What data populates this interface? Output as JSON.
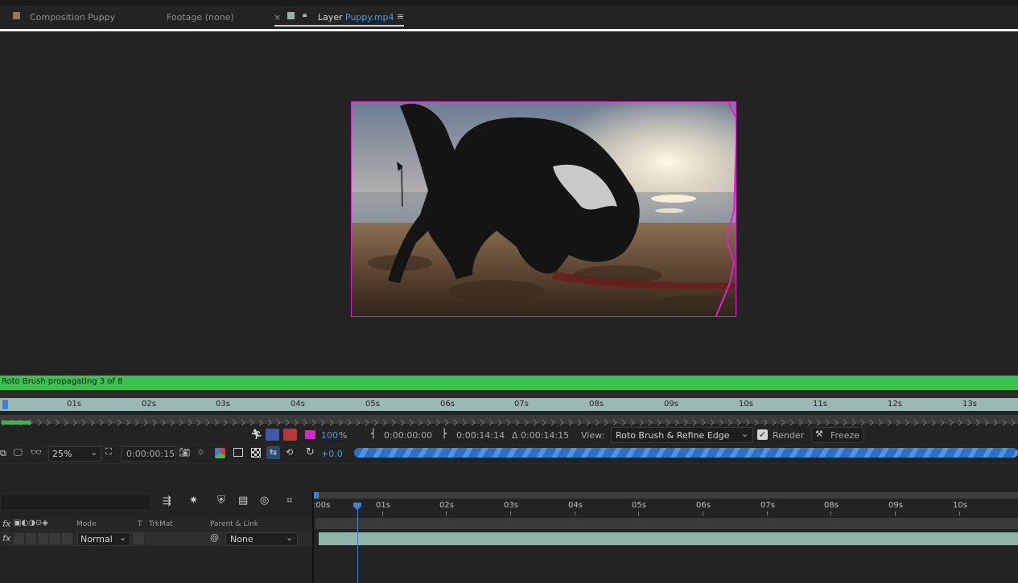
{
  "tabs": [
    {
      "label": "Composition Puppy",
      "color": "#8b7a67"
    },
    {
      "label": "Footage (none)"
    },
    {
      "label": "Layer",
      "link": "Puppy.mp4",
      "close": "×",
      "menu": "≡",
      "color": "#8fb5aa"
    }
  ],
  "roto_status": "Roto Brush propagating 3 of 8",
  "layer_ruler": {
    "ticks": [
      "01s",
      "02s",
      "03s",
      "04s",
      "05s",
      "06s",
      "07s",
      "08s",
      "09s",
      "10s",
      "11s",
      "12s",
      "13s"
    ]
  },
  "roto_toolbar": {
    "percent_value": "100",
    "percent_sign": "%",
    "in_time": "0:00:00:00",
    "out_time": "0:00:14:14",
    "duration": "Δ 0:00:14:15",
    "view_label": "View:",
    "view_value": "Roto Brush & Refine Edge",
    "render_label": "Render",
    "freeze_label": "Freeze",
    "overlay_color": "#e01fd0"
  },
  "viewer_controls": {
    "zoom": "25%",
    "timecode": "0:00:00:15",
    "exposure": "+0.0",
    "progress": 1.0
  },
  "timeline": {
    "ruler_ticks": [
      ":00s",
      "01s",
      "02s",
      "03s",
      "04s",
      "05s",
      "06s",
      "07s",
      "08s",
      "09s",
      "10s"
    ],
    "columns": {
      "mode": "Mode",
      "t": "T",
      "trkmat": "TrkMat",
      "parent": "Parent & Link"
    },
    "layer": {
      "mode": "Normal",
      "parent": "None"
    }
  },
  "colors": {
    "roto_bar": "#3ac24f",
    "accent": "#3d7fd6",
    "layer_bar": "#8fb5aa",
    "mask": "#e01fd0"
  }
}
